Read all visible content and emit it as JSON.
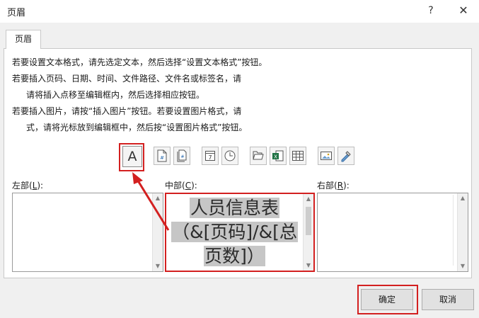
{
  "window": {
    "title": "页眉",
    "help_glyph": "?",
    "close_glyph": "✕"
  },
  "tabs": [
    {
      "label": "页眉"
    }
  ],
  "instructions": {
    "line1": "若要设置文本格式，请先选定文本，然后选择“设置文本格式”按钮。",
    "line2": "若要插入页码、日期、时间、文件路径、文件名或标签名，请",
    "line3": "请将插入点移至编辑框内，然后选择相应按钮。",
    "line4": "若要插入图片，请按“插入图片”按钮。若要设置图片格式，请",
    "line5": "式，请将光标放到编辑框中，然后按“设置图片格式”按钮。"
  },
  "toolbar": {
    "format_text_glyph": "A",
    "icons": [
      "format-text-icon",
      "page-number-icon",
      "total-pages-icon",
      "date-icon",
      "time-icon",
      "file-path-icon",
      "file-name-icon",
      "sheet-name-icon",
      "insert-picture-icon",
      "format-picture-icon"
    ]
  },
  "sections": {
    "left": {
      "label_prefix": "左部(",
      "accel": "L",
      "label_suffix": "):"
    },
    "center": {
      "label_prefix": "中部(",
      "accel": "C",
      "label_suffix": "):",
      "content_line1": "人员信息表",
      "content_line2": "（&[页码]/&[总",
      "content_line3": "页数]）"
    },
    "right": {
      "label_prefix": "右部(",
      "accel": "R",
      "label_suffix": "):"
    }
  },
  "buttons": {
    "ok": "确定",
    "cancel": "取消"
  },
  "colors": {
    "highlight": "#d32020",
    "selection": "#c6c6c6"
  }
}
